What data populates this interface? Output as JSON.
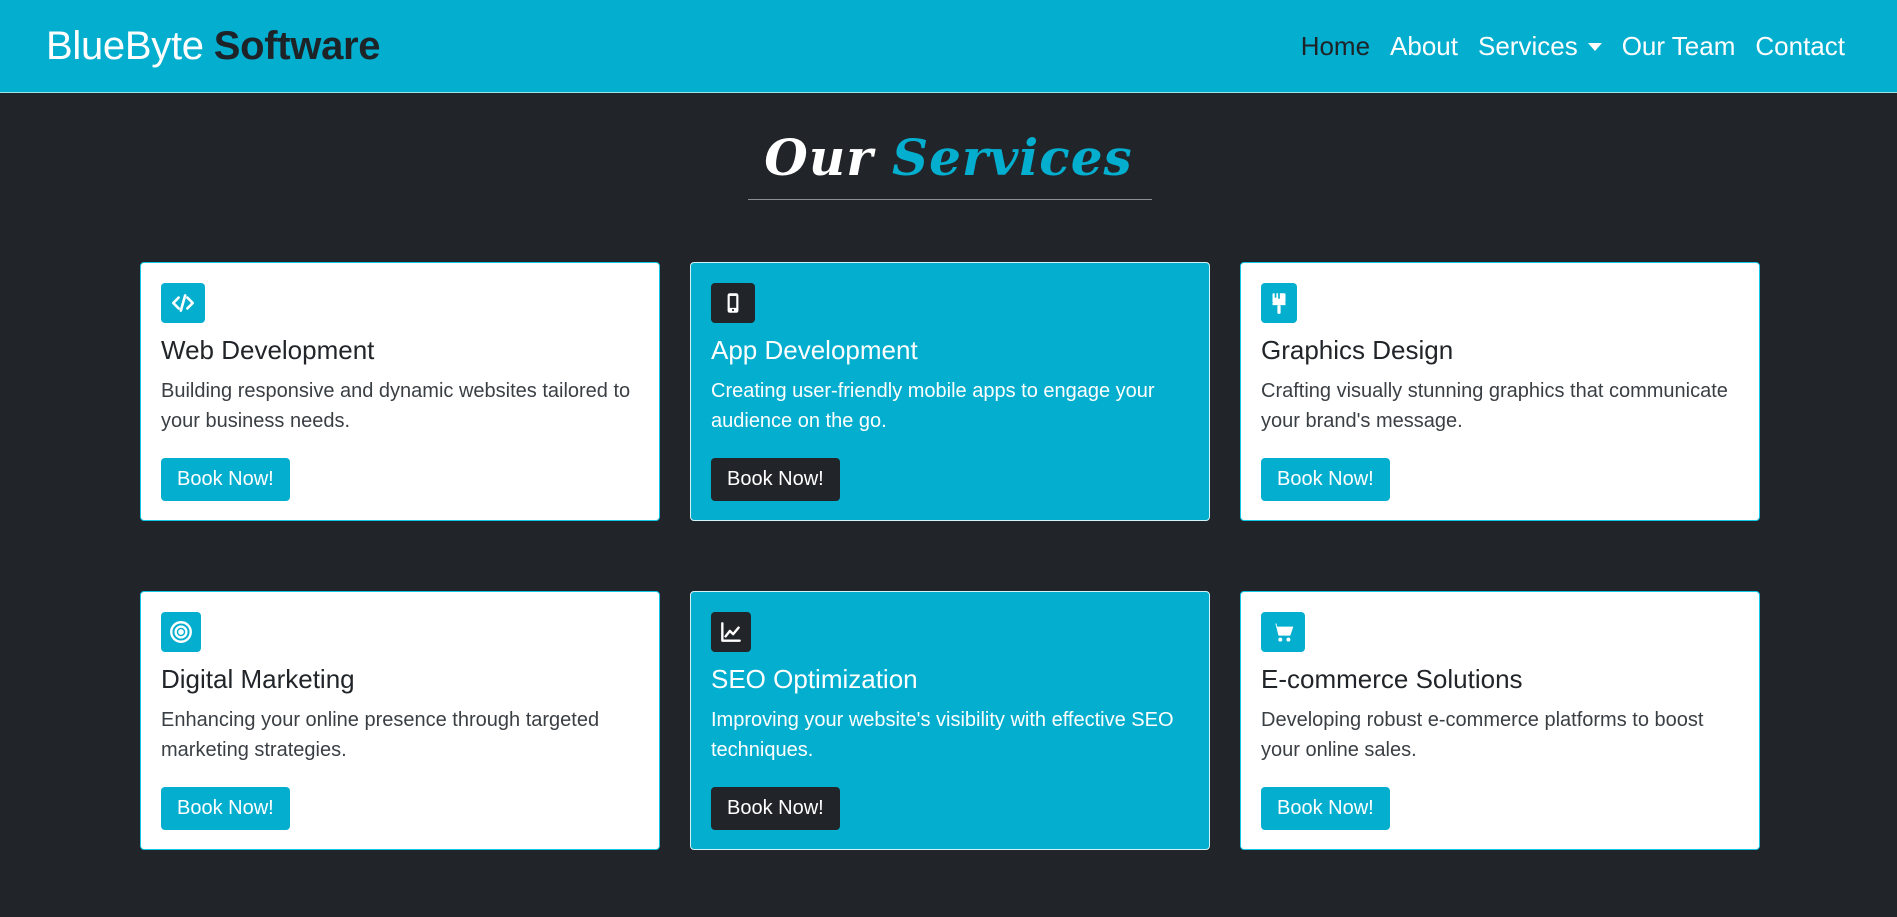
{
  "brand": {
    "part1": "BlueByte",
    "part2": "Software"
  },
  "nav": {
    "home": "Home",
    "about": "About",
    "services": "Services",
    "team": "Our Team",
    "contact": "Contact"
  },
  "section": {
    "title_part1": "Our",
    "title_part2": "Services"
  },
  "cards": [
    {
      "icon": "code-icon",
      "title": "Web Development",
      "text": "Building responsive and dynamic websites tailored to your business needs.",
      "button": "Book Now!"
    },
    {
      "icon": "mobile-icon",
      "title": "App Development",
      "text": "Creating user-friendly mobile apps to engage your audience on the go.",
      "button": "Book Now!"
    },
    {
      "icon": "paintbrush-icon",
      "title": "Graphics Design",
      "text": "Crafting visually stunning graphics that communicate your brand's message.",
      "button": "Book Now!"
    },
    {
      "icon": "target-icon",
      "title": "Digital Marketing",
      "text": "Enhancing your online presence through targeted marketing strategies.",
      "button": "Book Now!"
    },
    {
      "icon": "chart-line-icon",
      "title": "SEO Optimization",
      "text": "Improving your website's visibility with effective SEO techniques.",
      "button": "Book Now!"
    },
    {
      "icon": "cart-icon",
      "title": "E-commerce Solutions",
      "text": "Developing robust e-commerce platforms to boost your online sales.",
      "button": "Book Now!"
    }
  ],
  "colors": {
    "accent": "#03aecf",
    "dark": "#212529",
    "white": "#ffffff"
  }
}
